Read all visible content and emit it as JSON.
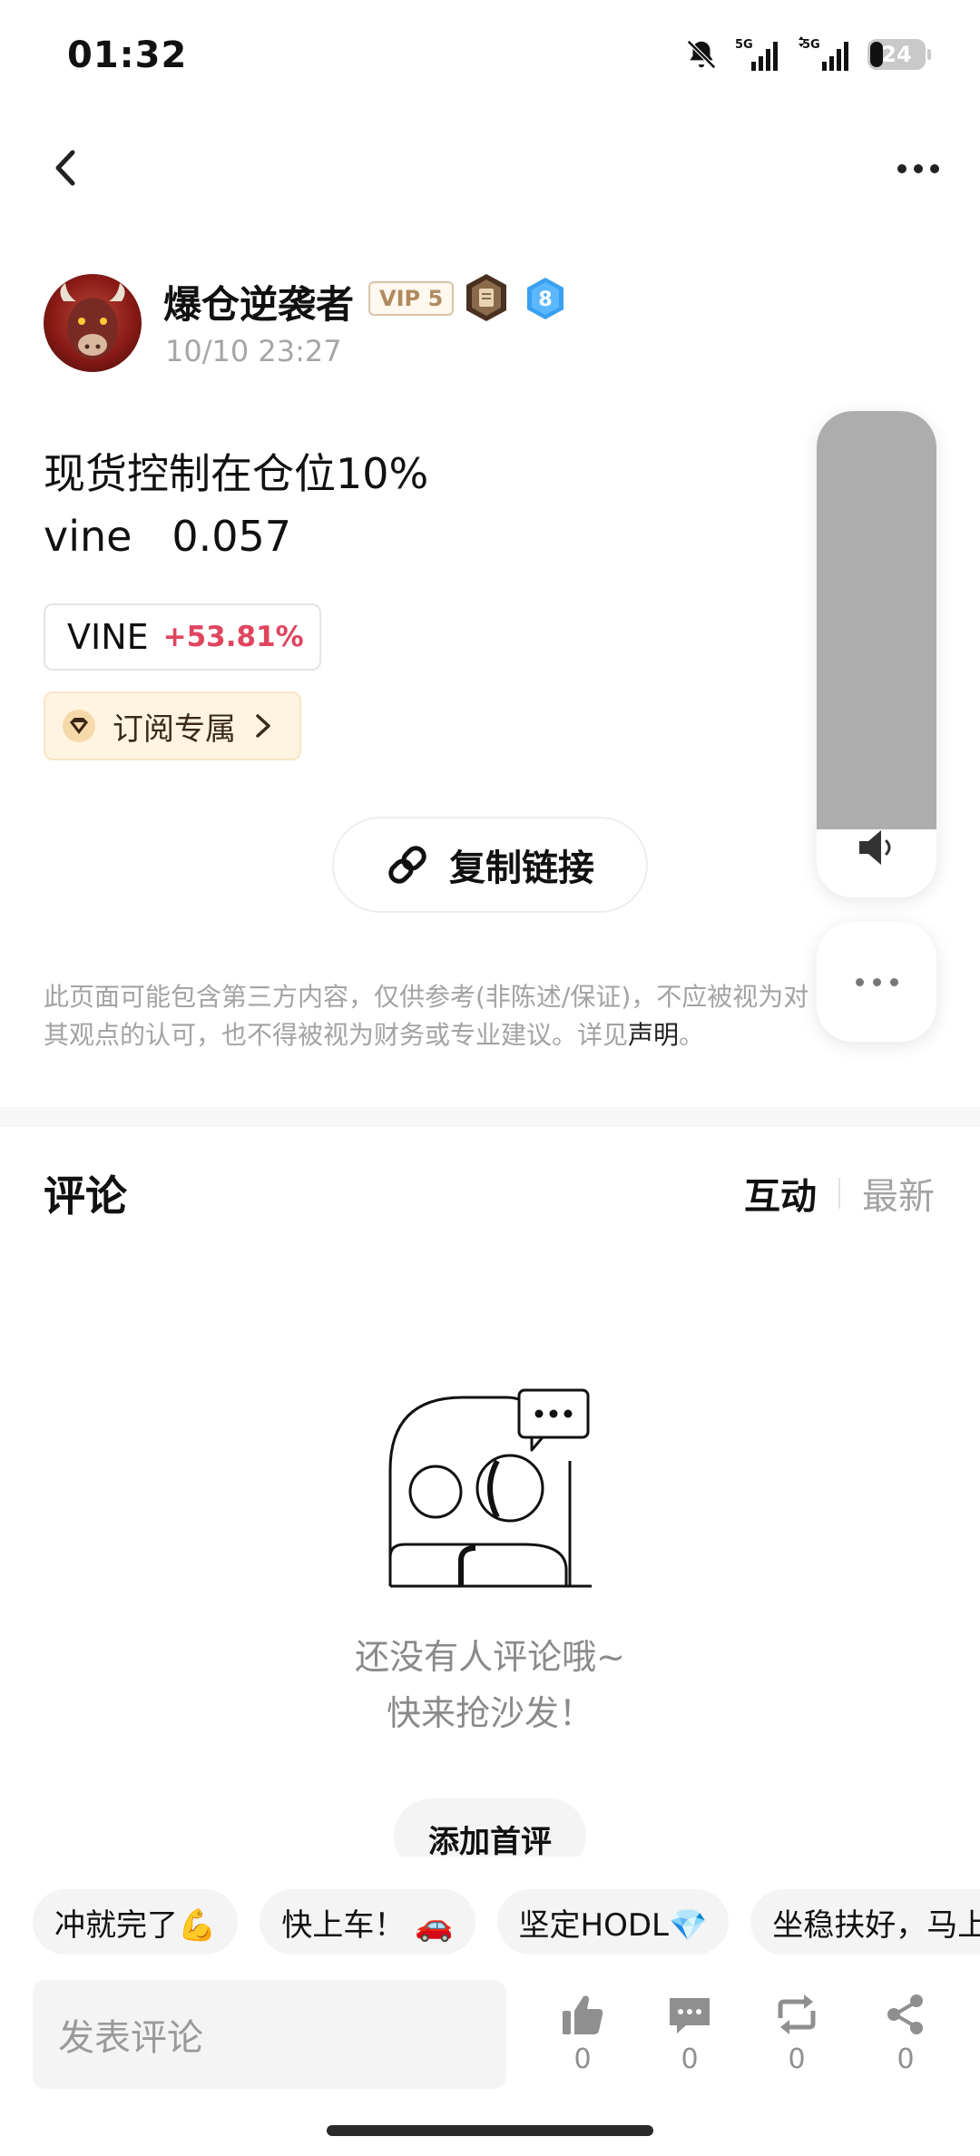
{
  "status_bar": {
    "time": "01:32",
    "battery_level": "24",
    "network_1": "5G",
    "network_2": "5G"
  },
  "header": {
    "back_icon": "chevron-left-icon",
    "more_icon": "more-horizontal-icon"
  },
  "author": {
    "name": "爆仓逆袭者",
    "vip_label": "VIP 5",
    "level": "8",
    "post_time": "10/10 23:27"
  },
  "post": {
    "line1": "现货控制在仓位10%",
    "line2": "vine   0.057"
  },
  "ticker": {
    "symbol": "VINE",
    "change": "+53.81%",
    "change_color": "#e0455e"
  },
  "subscribe": {
    "label": "订阅专属"
  },
  "copy_link": {
    "label": "复制链接"
  },
  "disclaimer": {
    "text": "此页面可能包含第三方内容，仅供参考(非陈述/保证)，不应被视为对其观点的认可，也不得被视为财务或专业建议。详见",
    "link": "声明",
    "end": "。"
  },
  "volume_overlay": {
    "level": 0.86,
    "icon": "volume-icon",
    "more_icon": "more-horizontal-icon"
  },
  "comments": {
    "title": "评论",
    "sort_active": "互动",
    "sort_inactive": "最新",
    "empty_line1": "还没有人评论哦~",
    "empty_line2": "快来抢沙发！",
    "first_comment_label": "添加首评"
  },
  "quick_replies": [
    "冲就完了💪",
    "快上车！ 🚗",
    "坚定HODL💎",
    "坐稳扶好，马上起飞"
  ],
  "bottom_bar": {
    "input_placeholder": "发表评论",
    "likes": "0",
    "comments": "0",
    "reposts": "0",
    "shares": "0"
  }
}
